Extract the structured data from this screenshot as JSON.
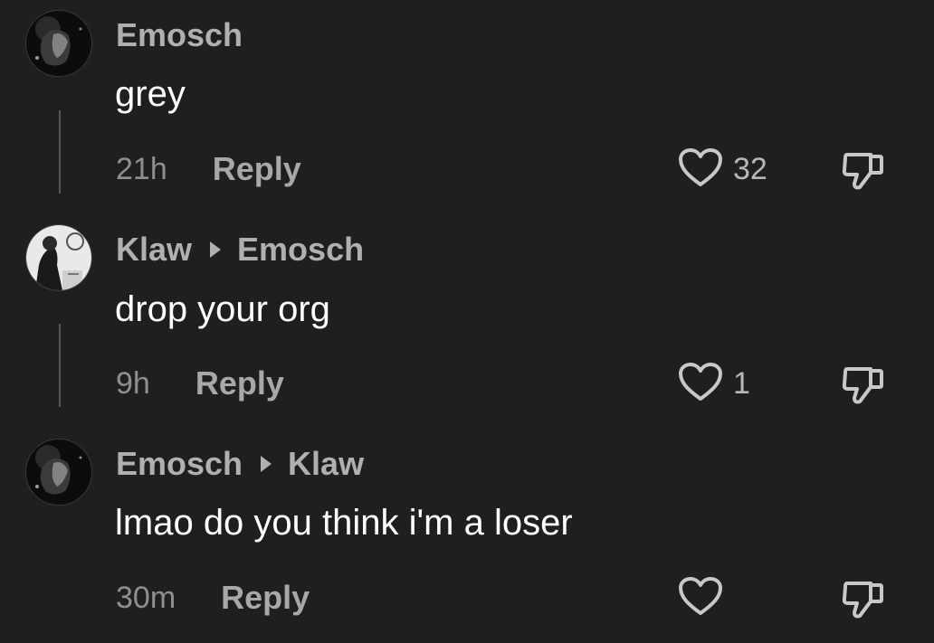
{
  "colors": {
    "background": "#1f1f1f",
    "username": "#b0b0b0",
    "body_text": "#ffffff",
    "timestamp": "#8f8f8f",
    "icon": "#c8c8c8"
  },
  "comments": [
    {
      "author": "Emosch",
      "reply_to": "",
      "text": "grey",
      "time": "21h",
      "reply_label": "Reply",
      "likes": "32",
      "avatar_icon": "profile-photo"
    },
    {
      "author": "Klaw",
      "reply_to": "Emosch",
      "text": "drop your org",
      "time": "9h",
      "reply_label": "Reply",
      "likes": "1",
      "avatar_icon": "profile-photo"
    },
    {
      "author": "Emosch",
      "reply_to": "Klaw",
      "text": "lmao do you think i'm a loser",
      "time": "30m",
      "reply_label": "Reply",
      "likes": "",
      "avatar_icon": "profile-photo"
    }
  ],
  "icons": {
    "like": "heart-outline-icon",
    "dislike": "thumbs-down-outline-icon",
    "reply_indicator": "triangle-right-icon"
  }
}
